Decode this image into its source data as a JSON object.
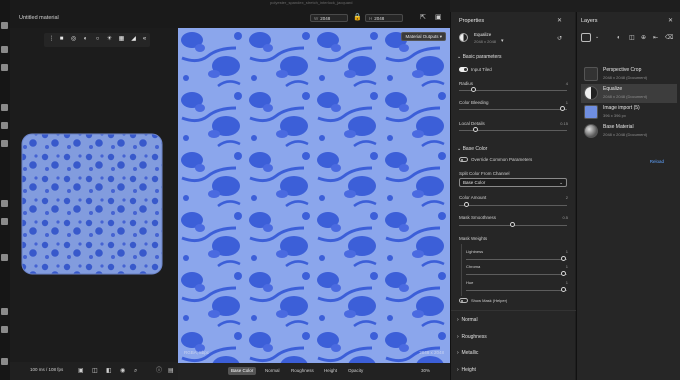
{
  "window": {
    "title": "polyester_spandex_stretch_interlock_jacquard"
  },
  "topbar": {
    "material_title": "Untitled material",
    "width_value": "2048",
    "height_value": "2048",
    "width_prefix": "W",
    "height_prefix": "H"
  },
  "viewport2d": {
    "material_outputs_label": "Material Outputs",
    "rgba_label": "RGBA, 8bpc",
    "resolution_label": "2048 x 2048",
    "channel_tabs": [
      "Base Color",
      "Normal",
      "Roughness",
      "Height",
      "Opacity"
    ],
    "selected_tab": "Base Color",
    "zoom_value": "30%"
  },
  "statusbar": {
    "fps": "100 ms / 108 fps"
  },
  "properties": {
    "panel_title": "Properties",
    "node_name": "Equalize",
    "node_size": "2048 x 2048",
    "basic_section": "Basic parameters",
    "input_tiled": "Input Tiled",
    "radius_label": "Radius",
    "radius_value": "4",
    "color_bleeding_label": "Color Bleeding",
    "color_bleeding_value": "1",
    "local_details_label": "Local Details",
    "local_details_value": "0.15",
    "base_color_section": "Base Color",
    "override_label": "Override Common Parameters",
    "split_label": "Split Color From Channel",
    "split_value": "Base Color",
    "color_amount_label": "Color Amount",
    "color_amount_value": "2",
    "mask_smooth_label": "Mask Smoothness",
    "mask_smooth_value": "0.5",
    "mask_weights_label": "Mask Weights",
    "lightness_label": "Lightness",
    "lightness_value": "1",
    "chroma_label": "Chroma",
    "chroma_value": "1",
    "hue_label": "Hue",
    "hue_value": "1",
    "show_mask_label": "Show Mask (Helper)",
    "sections": [
      "Normal",
      "Roughness",
      "Metallic",
      "Height"
    ]
  },
  "layers": {
    "panel_title": "Layers",
    "items": [
      {
        "name": "Perspective Crop",
        "sub": "2048 x 2048 (Document)"
      },
      {
        "name": "Equalize",
        "sub": "2048 x 2048 (Document)"
      },
      {
        "name": "Image import (5)",
        "sub": "396 x 396 px"
      },
      {
        "name": "Base Material",
        "sub": "2048 x 2048 (Document)"
      }
    ],
    "reload_label": "Reload"
  },
  "colors": {
    "accent": "#5fa3ff",
    "fabric_light": "#8ba6ec",
    "fabric_dark": "#3c5fd8",
    "panel": "#262626"
  }
}
